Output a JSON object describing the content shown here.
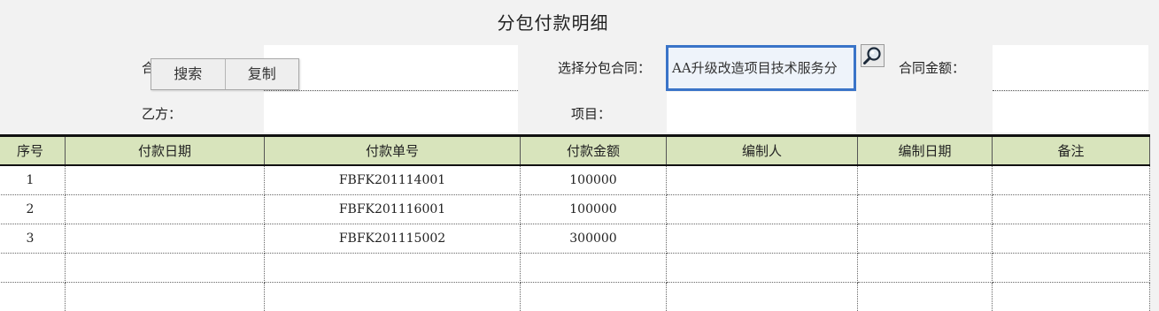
{
  "page": {
    "title": "分包付款明细"
  },
  "form": {
    "contract_label_partial": "合",
    "party_b_label": "乙方：",
    "select_contract_label": "选择分包合同：",
    "selected_contract_value": "AA升级改造项目技术服务分",
    "contract_amount_label": "合同金额：",
    "project_label": "项目："
  },
  "context_menu": {
    "search_label": "搜索",
    "copy_label": "复制"
  },
  "table": {
    "headers": [
      "序号",
      "付款日期",
      "付款单号",
      "付款金额",
      "编制人",
      "编制日期",
      "备注"
    ],
    "rows": [
      [
        "1",
        "",
        "FBFK201114001",
        "100000",
        "",
        "",
        ""
      ],
      [
        "2",
        "",
        "FBFK201116001",
        "100000",
        "",
        "",
        ""
      ],
      [
        "3",
        "",
        "FBFK201115002",
        "300000",
        "",
        "",
        ""
      ],
      [
        "",
        "",
        "",
        "",
        "",
        "",
        ""
      ],
      [
        "",
        "",
        "",
        "",
        "",
        "",
        ""
      ]
    ]
  }
}
